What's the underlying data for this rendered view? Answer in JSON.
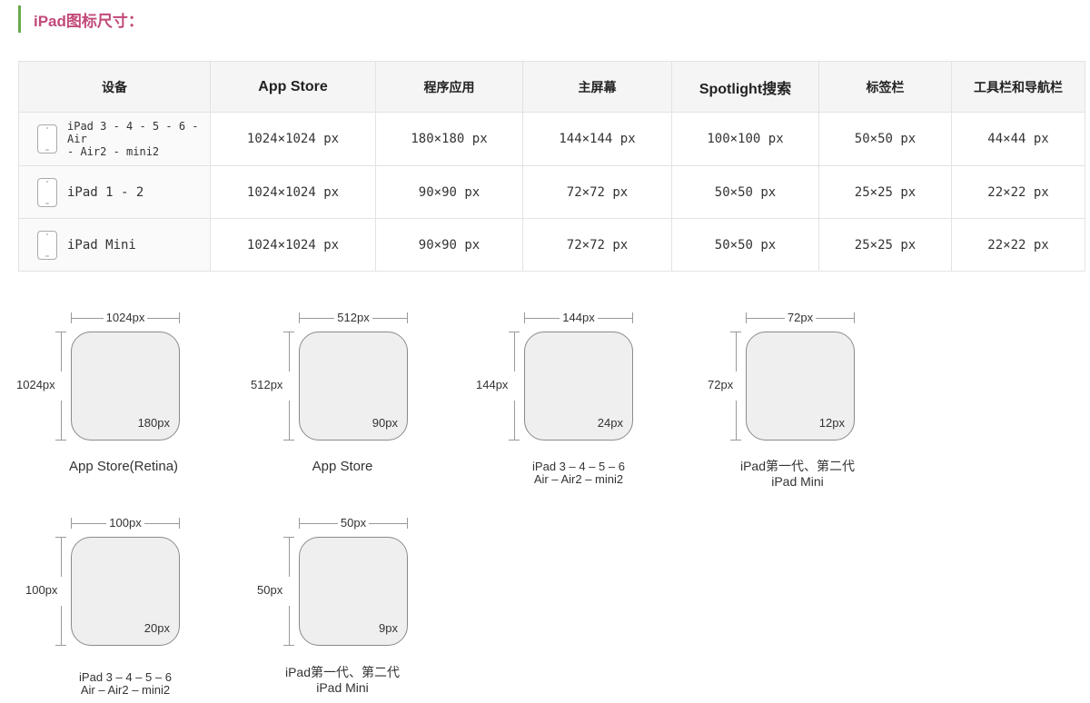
{
  "heading": "iPad图标尺寸：",
  "table": {
    "headers": [
      "设备",
      "App Store",
      "程序应用",
      "主屏幕",
      "Spotlight搜索",
      "标签栏",
      "工具栏和导航栏"
    ],
    "rows": [
      {
        "device_line1": "iPad 3 - 4 - 5 - 6 - Air",
        "device_line2": "- Air2 - mini2",
        "cells": [
          "1024×1024 px",
          "180×180 px",
          "144×144 px",
          "100×100 px",
          "50×50 px",
          "44×44 px"
        ]
      },
      {
        "device": "iPad 1 - 2",
        "cells": [
          "1024×1024 px",
          "90×90 px",
          "72×72 px",
          "50×50 px",
          "25×25 px",
          "22×22 px"
        ]
      },
      {
        "device": "iPad Mini",
        "cells": [
          "1024×1024 px",
          "90×90 px",
          "72×72 px",
          "50×50 px",
          "25×25 px",
          "22×22 px"
        ]
      }
    ]
  },
  "diagrams": [
    {
      "width_label": "1024px",
      "height_label": "1024px",
      "corner_label": "180px",
      "caption": "App Store(Retina)"
    },
    {
      "width_label": "512px",
      "height_label": "512px",
      "corner_label": "90px",
      "caption": "App Store"
    },
    {
      "width_label": "144px",
      "height_label": "144px",
      "corner_label": "24px",
      "caption_line1": "iPad 3 – 4 – 5 – 6",
      "caption_line2": "Air – Air2 – mini2"
    },
    {
      "width_label": "72px",
      "height_label": "72px",
      "corner_label": "12px",
      "caption_line1": "iPad第一代、第二代",
      "caption_line2": "iPad Mini"
    },
    {
      "width_label": "100px",
      "height_label": "100px",
      "corner_label": "20px",
      "caption_line1": "iPad 3 – 4 – 5 – 6",
      "caption_line2": "Air – Air2 – mini2"
    },
    {
      "width_label": "50px",
      "height_label": "50px",
      "corner_label": "9px",
      "caption_line1": "iPad第一代、第二代",
      "caption_line2": "iPad Mini"
    }
  ]
}
